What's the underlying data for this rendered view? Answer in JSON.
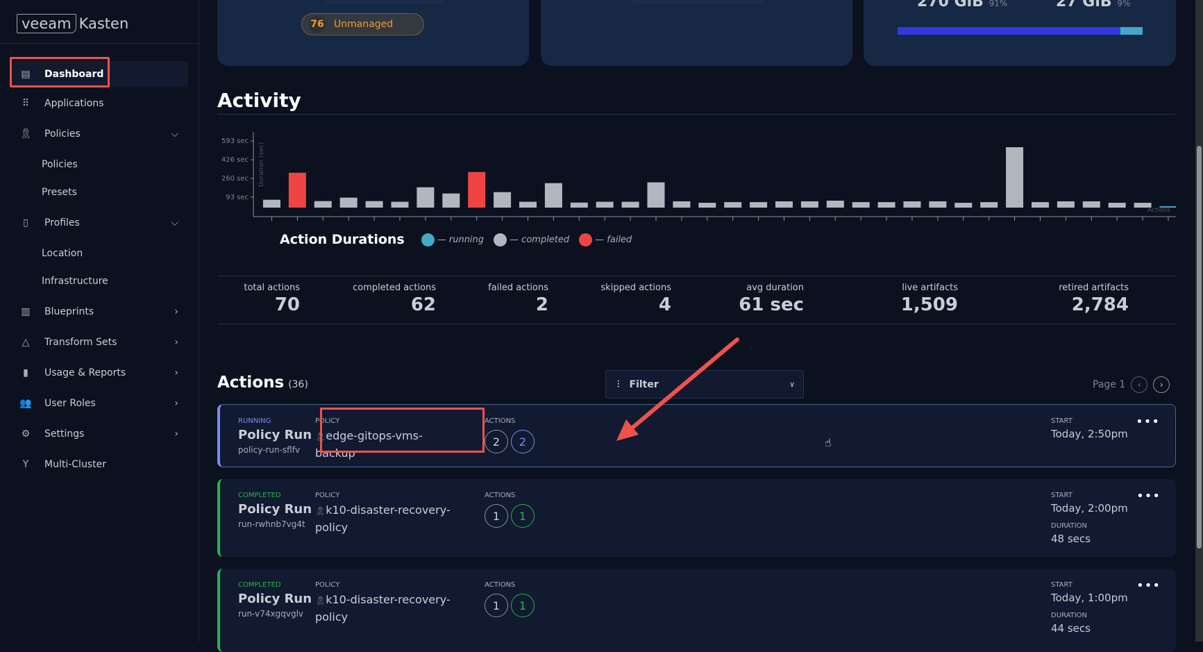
{
  "brand": {
    "logo_left": "veeam",
    "logo_right": "Kasten"
  },
  "sidebar": {
    "items": [
      {
        "label": "Dashboard",
        "icon": "layout-icon",
        "active": true
      },
      {
        "label": "Applications",
        "icon": "grid-dots-icon"
      },
      {
        "label": "Policies",
        "icon": "ribbon-icon",
        "chevron": "down"
      },
      {
        "label": "Policies",
        "sub": true
      },
      {
        "label": "Presets",
        "sub": true
      },
      {
        "label": "Profiles",
        "icon": "document-icon",
        "chevron": "down"
      },
      {
        "label": "Location",
        "sub": true
      },
      {
        "label": "Infrastructure",
        "sub": true
      },
      {
        "label": "Blueprints",
        "icon": "map-icon",
        "chevron": "right"
      },
      {
        "label": "Transform Sets",
        "icon": "shapes-icon",
        "chevron": "right"
      },
      {
        "label": "Usage & Reports",
        "icon": "bar-chart-icon",
        "chevron": "right"
      },
      {
        "label": "User Roles",
        "icon": "users-icon",
        "chevron": "right"
      },
      {
        "label": "Settings",
        "icon": "gear-icon",
        "chevron": "right"
      },
      {
        "label": "Multi-Cluster",
        "icon": "multi-cluster-icon"
      }
    ]
  },
  "top_cards": {
    "unmanaged": {
      "count": "76",
      "label": "Unmanaged"
    },
    "storage": {
      "used": "270 GiB",
      "used_pct": "91%",
      "free": "27 GiB",
      "free_pct": "9%",
      "fill_fraction": 0.91,
      "colors": {
        "used": "#3538df",
        "free": "#44a8c6"
      }
    }
  },
  "activity": {
    "title": "Activity",
    "legend_title": "Action Durations",
    "legend": [
      {
        "label": "— running",
        "color": "#44a8c6"
      },
      {
        "label": "— completed",
        "color": "#b1b7bf"
      },
      {
        "label": "— failed",
        "color": "#ef4444"
      }
    ]
  },
  "chart_data": {
    "type": "bar",
    "ylabel": "Duration (sec)",
    "xlabel": "Actions",
    "yticks": [
      "93 sec",
      "260 sec",
      "426 sec",
      "593 sec"
    ],
    "ytick_values": [
      93,
      260,
      426,
      593
    ],
    "ylim": [
      0,
      593
    ],
    "values": [
      70,
      311,
      58,
      89,
      58,
      52,
      181,
      126,
      317,
      138,
      52,
      218,
      45,
      52,
      52,
      225,
      56,
      43,
      49,
      49,
      56,
      56,
      62,
      49,
      49,
      56,
      56,
      43,
      49,
      538,
      49,
      56,
      56,
      43,
      43,
      8
    ],
    "status": [
      "completed",
      "failed",
      "completed",
      "completed",
      "completed",
      "completed",
      "completed",
      "completed",
      "failed",
      "completed",
      "completed",
      "completed",
      "completed",
      "completed",
      "completed",
      "completed",
      "completed",
      "completed",
      "completed",
      "completed",
      "completed",
      "completed",
      "completed",
      "completed",
      "completed",
      "completed",
      "completed",
      "completed",
      "completed",
      "completed",
      "completed",
      "completed",
      "completed",
      "completed",
      "completed",
      "running"
    ]
  },
  "stats": [
    {
      "label": "total actions",
      "value": "70"
    },
    {
      "label": "completed actions",
      "value": "62"
    },
    {
      "label": "failed actions",
      "value": "2"
    },
    {
      "label": "skipped actions",
      "value": "4"
    },
    {
      "label": "avg duration",
      "value": "61 sec"
    },
    {
      "label": "live artifacts",
      "value": "1,509"
    },
    {
      "label": "retired artifacts",
      "value": "2,784"
    }
  ],
  "actions": {
    "title": "Actions",
    "count": "(36)",
    "filter_label": "Filter",
    "page": "Page 1",
    "rows": [
      {
        "status": "RUNNING",
        "type": "Policy Run",
        "id": "policy-run-sflfv",
        "policy_label": "POLICY",
        "policy": "edge-gitops-vms-backup",
        "actions_label": "ACTIONS",
        "count_total": "2",
        "count_state": "2",
        "start_label": "START",
        "start": "Today, 2:50pm",
        "color": "#7b8cf0"
      },
      {
        "status": "COMPLETED",
        "type": "Policy Run",
        "id": "run-rwhnb7vg4t",
        "policy_label": "POLICY",
        "policy": "k10-disaster-recovery-policy",
        "actions_label": "ACTIONS",
        "count_total": "1",
        "count_state": "1",
        "start_label": "START",
        "start": "Today, 2:00pm",
        "duration_label": "DURATION",
        "duration": "48 secs",
        "color": "#2bb24c"
      },
      {
        "status": "COMPLETED",
        "type": "Policy Run",
        "id": "run-v74xgqvglv",
        "policy_label": "POLICY",
        "policy": "k10-disaster-recovery-policy",
        "actions_label": "ACTIONS",
        "count_total": "1",
        "count_state": "1",
        "start_label": "START",
        "start": "Today, 1:00pm",
        "duration_label": "DURATION",
        "duration": "44 secs",
        "color": "#2bb24c"
      }
    ]
  }
}
